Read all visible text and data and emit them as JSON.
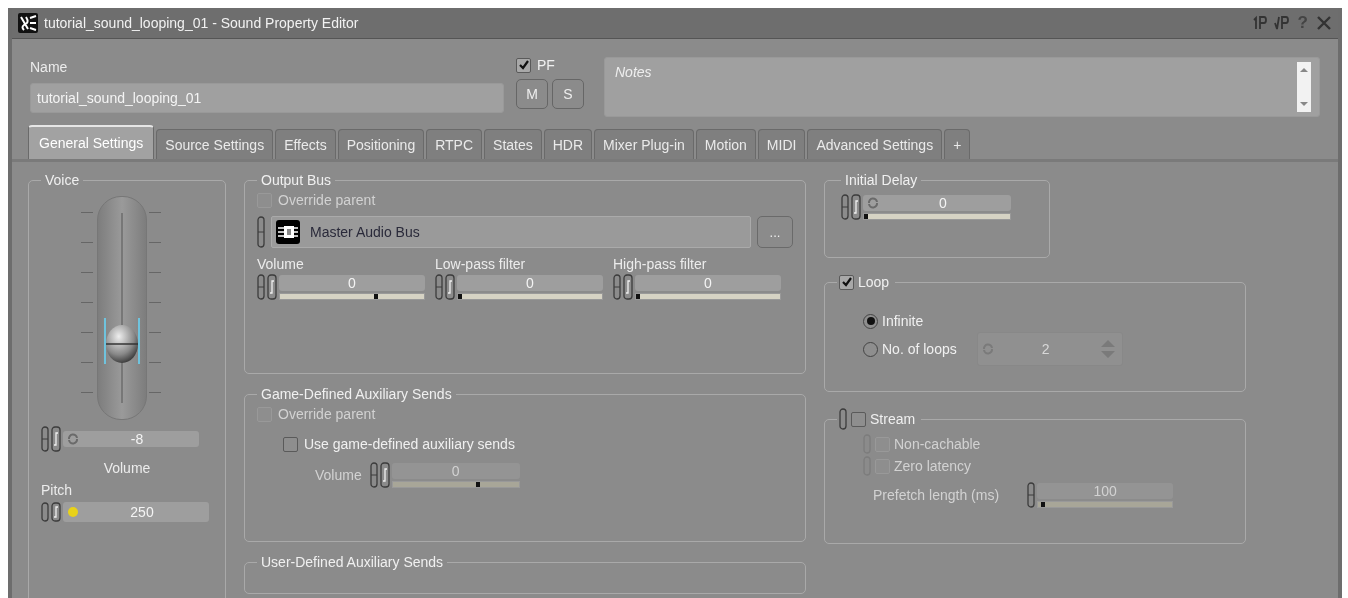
{
  "window": {
    "title": "tutorial_sound_looping_01 - Sound Property Editor",
    "help": "?"
  },
  "header": {
    "name_label": "Name",
    "name_value": "tutorial_sound_looping_01",
    "pf": {
      "label": "PF",
      "checked": true
    },
    "buttons": [
      "M",
      "S"
    ],
    "notes_placeholder": "Notes"
  },
  "tabs": [
    {
      "label": "General Settings",
      "selected": true
    },
    {
      "label": "Source Settings",
      "selected": false
    },
    {
      "label": "Effects",
      "selected": false
    },
    {
      "label": "Positioning",
      "selected": false
    },
    {
      "label": "RTPC",
      "selected": false
    },
    {
      "label": "States",
      "selected": false
    },
    {
      "label": "HDR",
      "selected": false
    },
    {
      "label": "Mixer Plug-in",
      "selected": false
    },
    {
      "label": "Motion",
      "selected": false
    },
    {
      "label": "MIDI",
      "selected": false
    },
    {
      "label": "Advanced Settings",
      "selected": false
    },
    {
      "label": "+",
      "selected": false
    }
  ],
  "voice": {
    "title": "Voice",
    "volume": {
      "level": 0.33,
      "value": "-8",
      "label": "Volume"
    },
    "pitch": {
      "label": "Pitch",
      "value": "250"
    }
  },
  "output_bus": {
    "title": "Output Bus",
    "override": {
      "label": "Override parent",
      "checked": false,
      "disabled": true
    },
    "bus": {
      "name": "Master Audio Bus",
      "browse": "..."
    },
    "sliders": [
      {
        "label": "Volume",
        "value": "0",
        "level": 0.65
      },
      {
        "label": "Low-pass filter",
        "value": "0",
        "level": 0
      },
      {
        "label": "High-pass filter",
        "value": "0",
        "level": 0
      }
    ]
  },
  "game_aux": {
    "title": "Game-Defined Auxiliary Sends",
    "override": {
      "label": "Override parent",
      "checked": false,
      "disabled": true
    },
    "use_game": {
      "label": "Use game-defined auxiliary sends",
      "checked": false,
      "disabled": false
    },
    "volume": {
      "label": "Volume",
      "value": "0",
      "level": 0.66,
      "disabled": true
    }
  },
  "user_aux": {
    "title": "User-Defined Auxiliary Sends"
  },
  "initial_delay": {
    "title": "Initial Delay",
    "value": "0",
    "level": 0
  },
  "loop": {
    "label": "Loop",
    "checked": true,
    "options": [
      {
        "label": "Infinite",
        "selected": true
      },
      {
        "label": "No. of loops",
        "selected": false
      }
    ],
    "count": {
      "value": "2",
      "disabled": true
    }
  },
  "stream": {
    "label": "Stream",
    "checked": false,
    "options": [
      {
        "label": "Non-cachable",
        "checked": false,
        "disabled": true
      },
      {
        "label": "Zero latency",
        "checked": false,
        "disabled": true
      }
    ],
    "prefetch": {
      "label": "Prefetch length (ms)",
      "value": "100",
      "level": 0.02,
      "disabled": true
    }
  }
}
